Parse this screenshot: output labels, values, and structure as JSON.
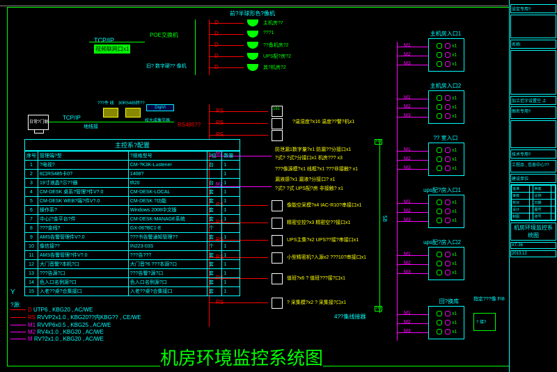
{
  "title": "机房环境监控系统图",
  "tcp": {
    "label": "TCP/IP",
    "box": "视频联网口x1"
  },
  "poe": "POE交换机",
  "note_under_poe": "旧? 数字硬?? 像机",
  "rs485_label": "RS485??",
  "top_devices": [
    {
      "tag": "D",
      "name": "主机房?7"
    },
    {
      "tag": "D",
      "name": "???1"
    },
    {
      "tag": "D",
      "name": "??备机房?2"
    },
    {
      "tag": "D",
      "name": "UPS配?房?2"
    },
    {
      "tag": "D",
      "name": "其?机房?2"
    }
  ],
  "top_header": "前?半球形色?像机",
  "mid_devices": [
    {
      "tag": "RS",
      "name": "?温湿度?x16 温度??警?机x1",
      "dev": "161"
    },
    {
      "tag": "RS",
      "name": "",
      "hidden": true
    },
    {
      "tag": "RS",
      "name": "",
      "hidden": true
    },
    {
      "tag": "",
      "name": "防泄漏1数字量?x1 防漏??分接口x1"
    },
    {
      "tag": "",
      "name": "M2",
      "sub": "?式? ?式?分接口x1 机房??? x3"
    },
    {
      "tag": "",
      "name": "???像源模?x1 线框?x1 ???非接触? x1"
    },
    {
      "tag": "",
      "name": "漏液感?x1 漏液?分接口? x1"
    },
    {
      "tag": "",
      "name": "M2",
      "sub": "?式? ?式 UPS配?房 非接触? x1"
    },
    {
      "tag": "RS",
      "name": "像能空采模?x4 IAC-R10?串接口x1"
    },
    {
      "tag": "RS",
      "name": "精密空控?x3 精密空??接口x1"
    },
    {
      "tag": "RS",
      "name": "UPS主集?x2 UPS??接?串接口x1"
    },
    {
      "tag": "RS",
      "name": "小型精密机?入源x2 ???10?串接口x1"
    },
    {
      "tag": "RS",
      "name": "值班?x6 ? 值班???接?口x1"
    },
    {
      "tag": "RS",
      "name": "? 采集模?x2 ? 采集接?口x1"
    }
  ],
  "junction_label": "4??集线接器",
  "junction_tags": [
    "HJ",
    "58",
    "HJ"
  ],
  "doors": [
    {
      "title": "主机房入口1",
      "m": [
        "M1",
        "M2",
        "M3"
      ],
      "x": [
        "x1",
        "x1",
        "x1"
      ]
    },
    {
      "title": "主机房入口2",
      "m": [
        "M1",
        "M2",
        "M3"
      ],
      "x": [
        "x1",
        "x1",
        "x1"
      ]
    },
    {
      "title": "?? 室入口",
      "m": [
        "M1",
        "M2",
        "M3"
      ],
      "x": [
        "x1",
        "x1",
        "x1"
      ]
    },
    {
      "title": "ups配?房入口1",
      "m": [
        "M1",
        "M2",
        "M3"
      ],
      "x": [
        "x1",
        "x1",
        "x1"
      ]
    },
    {
      "title": "ups配?房入口2",
      "m": [
        "M1",
        "M2",
        "M3"
      ],
      "x": [
        "x1",
        "x1",
        "x1"
      ]
    },
    {
      "title": "回?换库",
      "m": [
        "M1",
        "M2",
        "M3"
      ],
      "x": [
        "x1",
        "x1",
        "x1"
      ]
    }
  ],
  "legend": {
    "title": "?源:",
    "rows": [
      {
        "tag": "D",
        "spec": "UTP6 , KBG20 , AC/WE",
        "color": "#f00"
      },
      {
        "tag": "RS",
        "spec": "RVVP2x1.0 , KBG20??内KBG?? , CE/WE",
        "color": "#f00"
      },
      {
        "tag": "M1",
        "spec": "RVVP6x0.5 , KBG25 , AC/WE",
        "color": "#f0f"
      },
      {
        "tag": "M2",
        "spec": "RV4x1.0 , KBG20 , AC/WE",
        "color": "#f0f"
      },
      {
        "tag": "M",
        "spec": "RV?2x1.0 , KBG20 , AC/WE",
        "color": "#f0f"
      }
    ]
  },
  "yaxis": "Y",
  "table": {
    "title": "主控系?配置",
    "headers": [
      "序号",
      "管理端?型",
      "?规格型号",
      "?位",
      "数量"
    ],
    "rows": [
      [
        "1",
        "?电视?",
        "CM-?K3K-Lustener",
        "台",
        "1"
      ],
      [
        "2",
        "8口RS485卡0?",
        "1408?",
        "",
        "1"
      ],
      [
        "3",
        "19寸液晶?示??器",
        "tft20",
        "台",
        "1"
      ],
      [
        "4",
        "CM-DESK 桌系?管理?件V?.0",
        "CM-DESK-LOCAL",
        "套",
        "1"
      ],
      [
        "5",
        "CM-DESK WEB?端?件V?.0",
        "CM-DESK ?功能",
        "套",
        "1"
      ],
      [
        "6",
        "操作系?",
        "Windows 2008中文版",
        "套",
        "1"
      ],
      [
        "7",
        "中心|?金平台?件",
        "CM-DESK-MANAGE系统",
        "套",
        "1"
      ],
      [
        "8",
        "???金线?",
        "GX-06?BC1-E",
        "个",
        ""
      ],
      [
        "9",
        "AMS告警管理件V?.0",
        "???书告警通知管理??",
        "套",
        "1"
      ],
      [
        "10",
        "像信接??",
        "IN223-03S",
        "个",
        "1"
      ],
      [
        "11",
        "AMS告警管理?件V?.0",
        "???告???",
        "套",
        "1"
      ],
      [
        "12",
        "大门音警?本机?口",
        "大门音?6 ???本源?口",
        "套",
        "1"
      ],
      [
        "13",
        "???告源?口",
        "???告警?源?口",
        "套",
        "1"
      ],
      [
        "14",
        "色入口名例源?口",
        "色入口名例源?口",
        "套",
        "1"
      ],
      [
        "15",
        "入老??桌?合集接口",
        "入老??桌?合集接口",
        "套",
        "1"
      ]
    ]
  },
  "sidebar": {
    "top": "设定专用?",
    "name": "名称:",
    "block1": "加工范字设置空 上",
    "block2": "图名专用?",
    "block3": "技术专用?",
    "block4": "工程品 , 信息中心??",
    "block5": "建设单位:",
    "grid": [
      [
        "批准",
        "",
        "换底",
        ""
      ],
      [
        "审核",
        "",
        "比例",
        ""
      ],
      [
        "校对",
        "",
        "日期",
        ""
      ],
      [
        "设计",
        "",
        "图号",
        ""
      ],
      [
        "制图",
        "",
        "张号",
        ""
      ]
    ],
    "drawing_title": "机房环境监控系统图",
    "sub": "指定???像 FI8",
    "code": "XT-36",
    "date": "2013.12",
    "box_right": "? 接?"
  },
  "converters": {
    "a": "???件 线",
    "b": "30RS485转??",
    "c": "DigiVi",
    "d": "校大成像节器"
  },
  "pc_label": "日常?门联",
  "grounding": "地线接"
}
